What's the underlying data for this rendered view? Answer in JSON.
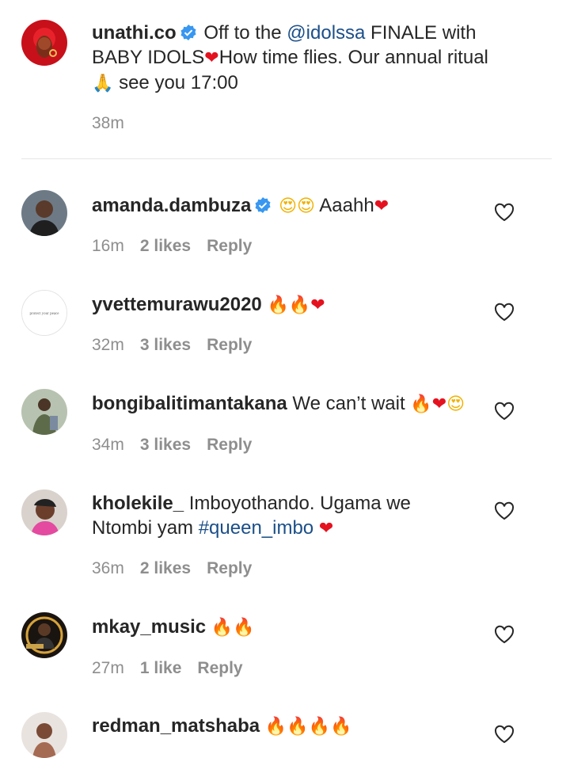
{
  "caption": {
    "username": "unathi.co",
    "text_pre": "Off to the ",
    "mention": "@idolssa",
    "text_post": " FINALE with",
    "line2": "BABY IDOLS",
    "line2b": "How time flies. Our annual ritual",
    "line3": " see you 17:00",
    "time": "38m"
  },
  "comments": [
    {
      "username": "amanda.dambuza",
      "verified": true,
      "text": "Aaahh",
      "time": "16m",
      "likes": "2 likes",
      "reply": "Reply"
    },
    {
      "username": "yvettemurawu2020",
      "text": "",
      "time": "32m",
      "likes": "3 likes",
      "reply": "Reply",
      "avatar_text": "protect your peace"
    },
    {
      "username": "bongibalitimantakana",
      "text": "We can’t wait",
      "time": "34m",
      "likes": "3 likes",
      "reply": "Reply"
    },
    {
      "username": "kholekile_",
      "text": "Imboyothando. Ugama we",
      "text2": "Ntombi yam ",
      "hashtag": "#queen_imbo",
      "time": "36m",
      "likes": "2 likes",
      "reply": "Reply"
    },
    {
      "username": "mkay_music",
      "text": "",
      "time": "27m",
      "likes": "1 like",
      "reply": "Reply"
    },
    {
      "username": "redman_matshaba",
      "text": ""
    }
  ],
  "icons": {
    "verified": "verified-badge-icon",
    "like": "heart-outline-icon",
    "fire": "🔥",
    "heart": "❤",
    "smile": "😍",
    "pray": "🙏"
  },
  "colors": {
    "text": "#262626",
    "muted": "#8e8e8e",
    "link": "#1b4f88",
    "verified": "#3897f0"
  }
}
